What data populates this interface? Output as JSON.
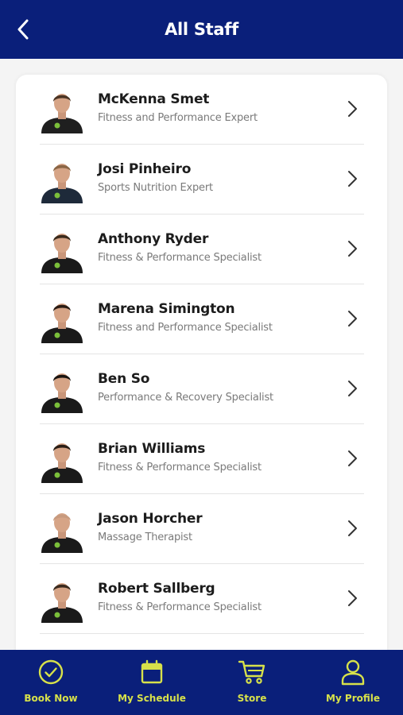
{
  "header": {
    "title": "All Staff",
    "back_icon": "chevron-left-icon"
  },
  "staff": [
    {
      "name": "McKenna Smet",
      "role": "Fitness and Performance Expert",
      "shirt": "#1f1f1f",
      "hair": "#4a3424"
    },
    {
      "name": "Josi Pinheiro",
      "role": "Sports Nutrition Expert",
      "shirt": "#1e2a3a",
      "hair": "#8a6545"
    },
    {
      "name": "Anthony Ryder",
      "role": "Fitness & Performance Specialist",
      "shirt": "#1a1a1a",
      "hair": "#3a2a1c"
    },
    {
      "name": "Marena Simington",
      "role": "Fitness and Performance Specialist",
      "shirt": "#1a1a1a",
      "hair": "#2a1c14"
    },
    {
      "name": "Ben So",
      "role": "Performance & Recovery Specialist",
      "shirt": "#1a1a1a",
      "hair": "#1a1410"
    },
    {
      "name": "Brian Williams",
      "role": "Fitness & Performance Specialist",
      "shirt": "#1a1a1a",
      "hair": "#2a1e16"
    },
    {
      "name": "Jason Horcher",
      "role": "Massage Therapist",
      "shirt": "#1a1a1a",
      "hair": "#c79a7e"
    },
    {
      "name": "Robert Sallberg",
      "role": "Fitness & Performance Specialist",
      "shirt": "#1a1a1a",
      "hair": "#3a2a1e"
    }
  ],
  "nav": [
    {
      "label": "Book Now",
      "icon": "check-circle-icon"
    },
    {
      "label": "My Schedule",
      "icon": "calendar-icon"
    },
    {
      "label": "Store",
      "icon": "cart-icon"
    },
    {
      "label": "My Profile",
      "icon": "user-icon"
    }
  ],
  "colors": {
    "brand": "#0a1f7a",
    "accent": "#d7e14a",
    "chevron": "#333333"
  }
}
